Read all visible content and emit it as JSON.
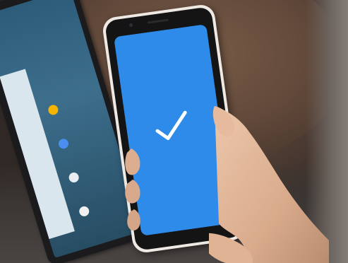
{
  "scene": {
    "description_free": true
  },
  "phone": {
    "screen_color": "#2f8bea",
    "bezel_color": "#141414",
    "body_color": "#efe9e4",
    "icon": "checkmark-icon"
  },
  "tablet": {
    "screen_color": "#2c5c7a"
  },
  "colors": {
    "table": "#62493a",
    "skin": "#e0b89c"
  }
}
